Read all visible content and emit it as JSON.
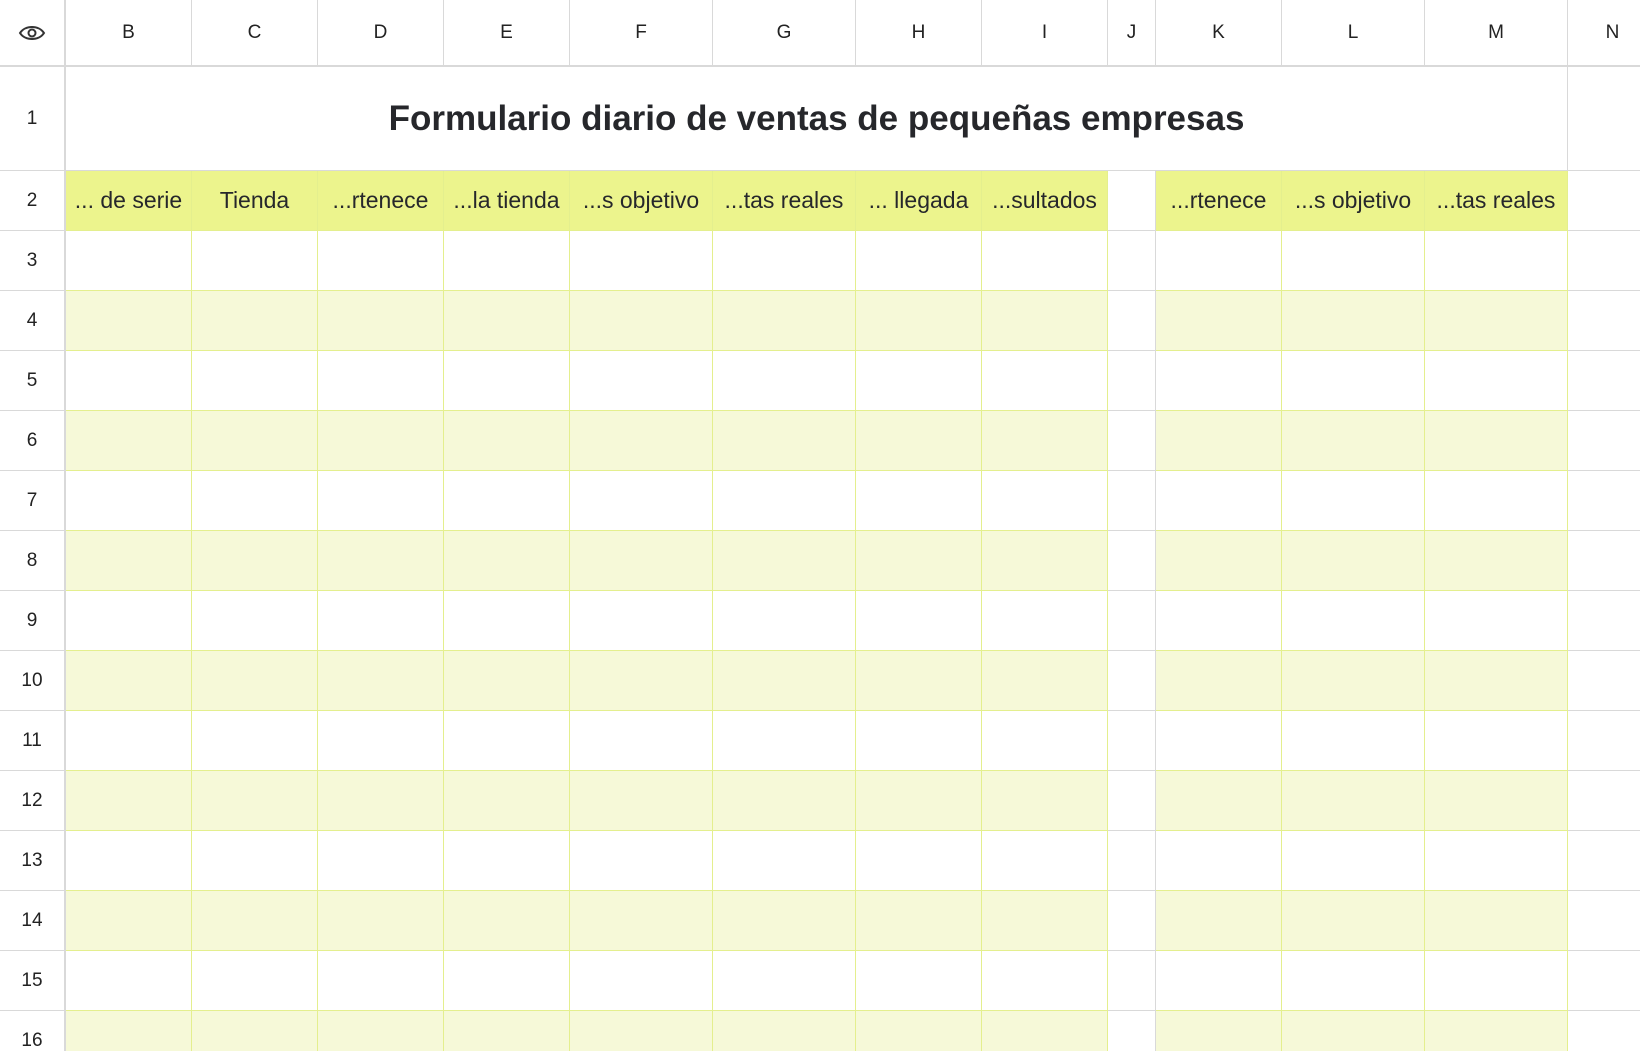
{
  "sheet": {
    "columns": [
      "B",
      "C",
      "D",
      "E",
      "F",
      "G",
      "H",
      "I",
      "J",
      "K",
      "L",
      "M",
      "N"
    ],
    "rows": [
      "1",
      "2",
      "3",
      "4",
      "5",
      "6",
      "7",
      "8",
      "9",
      "10",
      "11",
      "12",
      "13",
      "14",
      "15",
      "16"
    ],
    "title": "Formulario diario de ventas de pequeñas empresas",
    "headers": [
      "... de serie",
      "Tienda",
      "...rtenece",
      "...la tienda",
      "...s objetivo",
      "...tas reales",
      "... llegada",
      "...sultados",
      "",
      "...rtenece",
      "...s objetivo",
      "...tas reales"
    ],
    "corner_icon": "eye-icon",
    "colors": {
      "header_fill": "#ecf48d",
      "band_fill": "#f6f9d8",
      "plain_fill": "#ffffff",
      "grid_line": "#e4ef8e",
      "chrome_line": "#d9d9d9"
    }
  }
}
